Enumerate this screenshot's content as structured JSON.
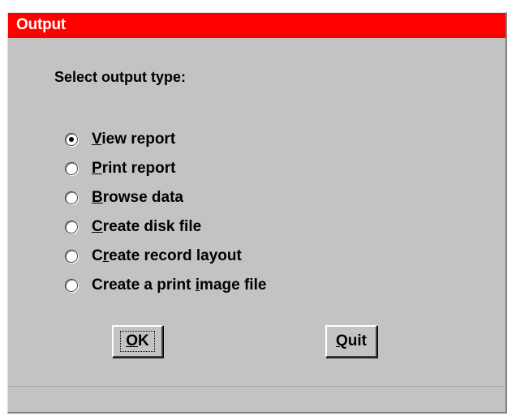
{
  "window": {
    "title": "Output",
    "title_bar_color": "#fe0000",
    "background_color": "#c3c3c3"
  },
  "prompt": "Select output type:",
  "options": [
    {
      "pre": "",
      "mnemonic": "V",
      "post": "iew report",
      "selected": true
    },
    {
      "pre": "",
      "mnemonic": "P",
      "post": "rint report",
      "selected": false
    },
    {
      "pre": "",
      "mnemonic": "B",
      "post": "rowse data",
      "selected": false
    },
    {
      "pre": "",
      "mnemonic": "C",
      "post": "reate disk file",
      "selected": false
    },
    {
      "pre": "C",
      "mnemonic": "r",
      "post": "eate record layout",
      "selected": false
    },
    {
      "pre": "Create a print ",
      "mnemonic": "i",
      "post": "mage file",
      "selected": false
    }
  ],
  "buttons": {
    "ok": {
      "mnemonic": "O",
      "rest": "K"
    },
    "quit": {
      "mnemonic": "Q",
      "rest": "uit"
    }
  }
}
